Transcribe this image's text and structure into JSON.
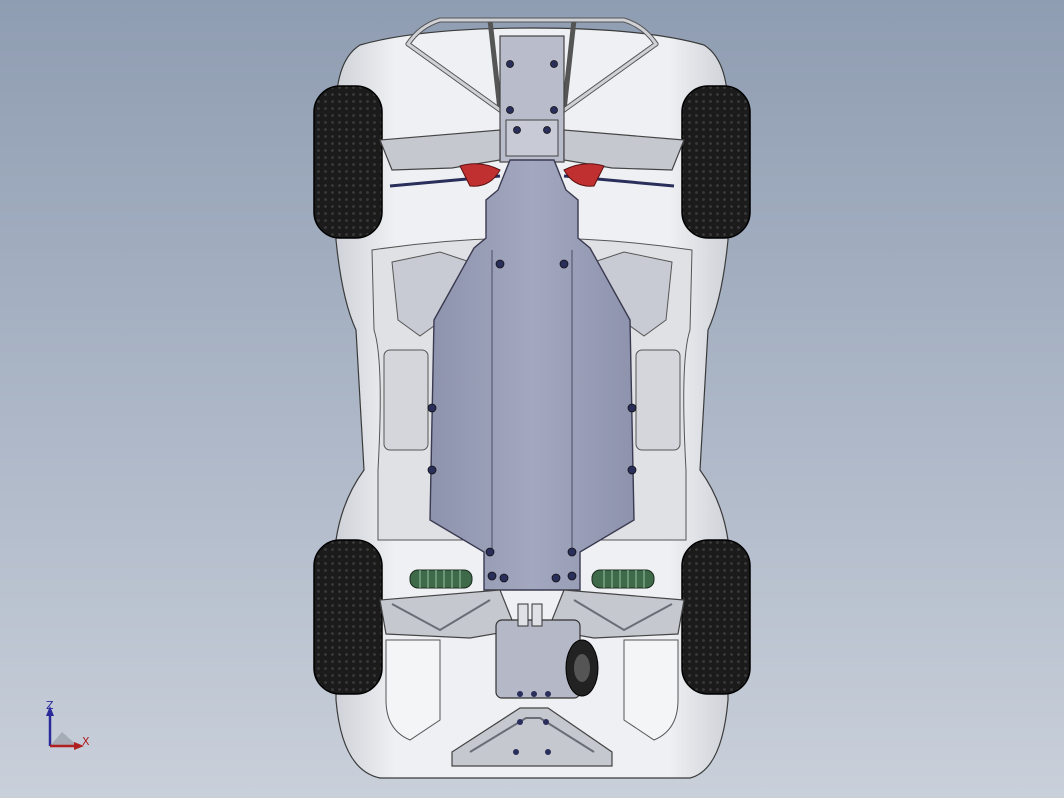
{
  "app": {
    "view": "bottom",
    "background_top": "#8f9db2",
    "background_bottom": "#c9d0da"
  },
  "colors": {
    "body_shell": "#e4e6ea",
    "chassis_plate": "#9aa0b8",
    "arms": "#c2c4cc",
    "tires": "#1b1b1b",
    "shock_springs": "#3e6a4a",
    "steering_links": "#c03030",
    "screws": "#2a2e5a"
  },
  "triad": {
    "z_label": "Z",
    "x_label": "X",
    "z_color": "#2a2a9a",
    "x_color": "#b02020"
  }
}
